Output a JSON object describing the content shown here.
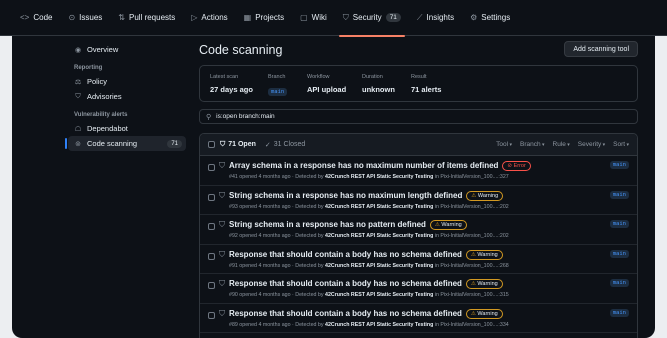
{
  "topnav": [
    {
      "icon": "<>",
      "label": "Code",
      "name": "code"
    },
    {
      "icon": "⊙",
      "label": "Issues",
      "name": "issues"
    },
    {
      "icon": "⇅",
      "label": "Pull requests",
      "name": "pull-requests"
    },
    {
      "icon": "▷",
      "label": "Actions",
      "name": "actions"
    },
    {
      "icon": "▦",
      "label": "Projects",
      "name": "projects"
    },
    {
      "icon": "▢",
      "label": "Wiki",
      "name": "wiki"
    },
    {
      "icon": "⛉",
      "label": "Security",
      "name": "security",
      "counter": "71",
      "active": true
    },
    {
      "icon": "⟋",
      "label": "Insights",
      "name": "insights"
    },
    {
      "icon": "⚙",
      "label": "Settings",
      "name": "settings"
    }
  ],
  "sidebar": {
    "overview": "Overview",
    "reporting_head": "Reporting",
    "policy": "Policy",
    "advisories": "Advisories",
    "vuln_head": "Vulnerability alerts",
    "dependabot": "Dependabot",
    "code_scanning": "Code scanning",
    "code_scanning_count": "71"
  },
  "main": {
    "title": "Code scanning",
    "add_button": "Add scanning tool",
    "info": {
      "latest_scan_label": "Latest scan",
      "latest_scan": "27 days ago",
      "branch_label": "Branch",
      "branch": "main",
      "workflow_label": "Workflow",
      "workflow": "API upload",
      "duration_label": "Duration",
      "duration": "unknown",
      "result_label": "Result",
      "result": "71 alerts"
    },
    "search_value": "is:open branch:main",
    "list": {
      "open": "71 Open",
      "closed": "31 Closed",
      "filters": [
        "Tool",
        "Branch",
        "Rule",
        "Severity",
        "Sort"
      ]
    }
  },
  "alerts": [
    {
      "title": "Array schema in a response has no maximum number of items defined",
      "severity": "Error",
      "sev_type": "err",
      "meta_prefix": "#41 opened 4 months ago · Detected by ",
      "tool": "42Crunch REST API Static Security Testing",
      "meta_suffix": " in Pixi-InitialVersion_100....:327",
      "branch": "main"
    },
    {
      "title": "String schema in a response has no maximum length defined",
      "severity": "Warning",
      "sev_type": "warn",
      "meta_prefix": "#93 opened 4 months ago · Detected by ",
      "tool": "42Crunch REST API Static Security Testing",
      "meta_suffix": " in Pixi-InitialVersion_100....:202",
      "branch": "main"
    },
    {
      "title": "String schema in a response has no pattern defined",
      "severity": "Warning",
      "sev_type": "warn",
      "meta_prefix": "#92 opened 4 months ago · Detected by ",
      "tool": "42Crunch REST API Static Security Testing",
      "meta_suffix": " in Pixi-InitialVersion_100....:202",
      "branch": "main"
    },
    {
      "title": "Response that should contain a body has no schema defined",
      "severity": "Warning",
      "sev_type": "warn",
      "meta_prefix": "#91 opened 4 months ago · Detected by ",
      "tool": "42Crunch REST API Static Security Testing",
      "meta_suffix": " in Pixi-InitialVersion_100....:268",
      "branch": "main"
    },
    {
      "title": "Response that should contain a body has no schema defined",
      "severity": "Warning",
      "sev_type": "warn",
      "meta_prefix": "#90 opened 4 months ago · Detected by ",
      "tool": "42Crunch REST API Static Security Testing",
      "meta_suffix": " in Pixi-InitialVersion_100....:315",
      "branch": "main"
    },
    {
      "title": "Response that should contain a body has no schema defined",
      "severity": "Warning",
      "sev_type": "warn",
      "meta_prefix": "#89 opened 4 months ago · Detected by ",
      "tool": "42Crunch REST API Static Security Testing",
      "meta_suffix": " in Pixi-InitialVersion_100....:334",
      "branch": "main"
    }
  ],
  "colors": {
    "accent": "#2f81f7",
    "active_tab": "#f78166",
    "error": "#f85149",
    "warning": "#d29922"
  }
}
